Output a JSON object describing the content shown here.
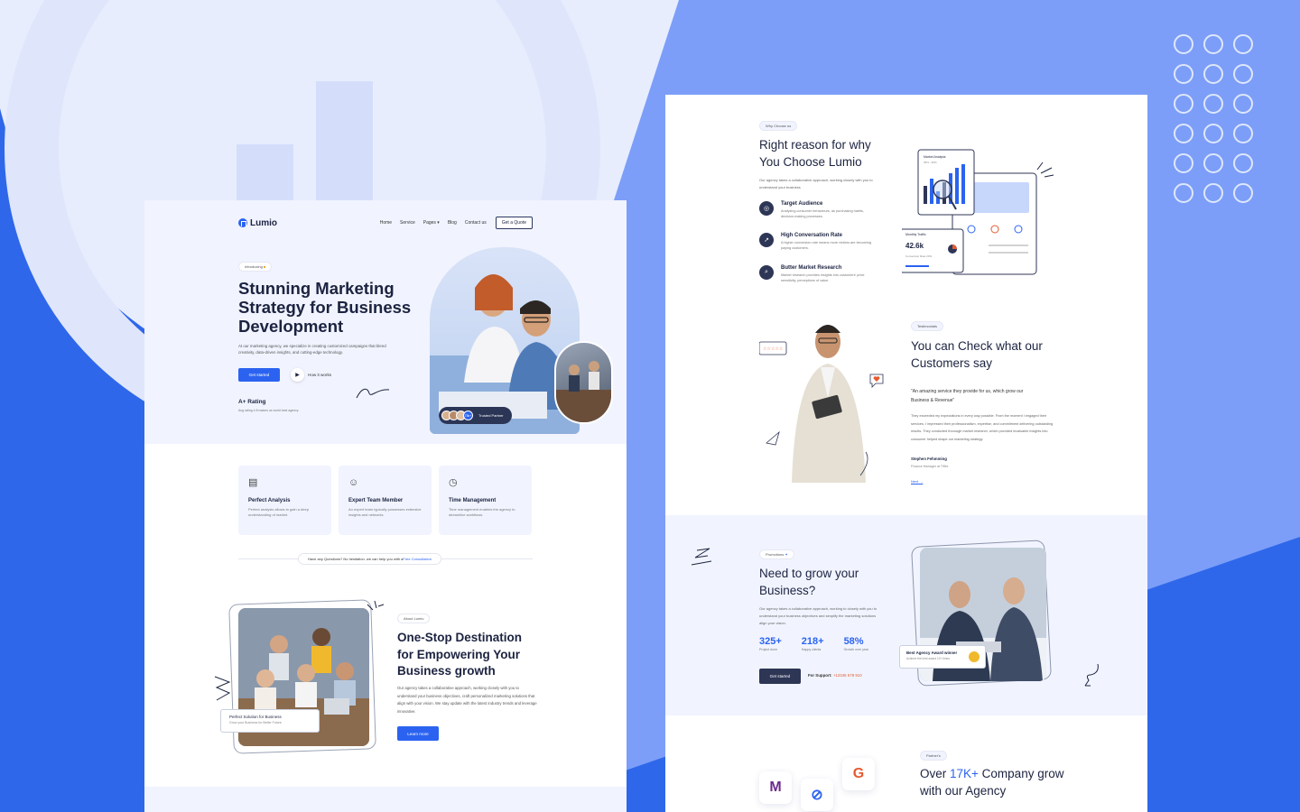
{
  "left_page": {
    "logo": "Lumio",
    "nav": [
      "Home",
      "Service",
      "Pages",
      "Blog",
      "Contact us"
    ],
    "quote_button": "Get a Quote",
    "hero": {
      "badge": "Introducing",
      "title": "Stunning Marketing Strategy for Business Development",
      "description": "At our marketing agency, we specialize in creating customized campaigns that blend creativity, data-driven insights, and cutting-edge technology.",
      "cta": "Get started",
      "play_label": "How it works",
      "rating_title": "A+ Rating",
      "rating_desc": "Avg rating 4.8 makes us world best agency",
      "trusted": "Trusted Partner",
      "avatar_more": "75k+"
    },
    "features": [
      {
        "icon": "analysis-icon",
        "title": "Perfect Analysis",
        "desc": "Perfect analysis allows to gain a deep understanding of market."
      },
      {
        "icon": "team-icon",
        "title": "Expert Team Member",
        "desc": "An expert team typically possesses extensive insights and networks."
      },
      {
        "icon": "clock-icon",
        "title": "Time Management",
        "desc": "Time management enables the agency to streamline workflows."
      }
    ],
    "question": {
      "text": "Have any Questions? No hesitation. we can help you with a ",
      "link": "Free Consultation"
    },
    "about": {
      "badge": "About Lumio",
      "title": "One-Stop Destination for Empowering Your Business growth",
      "description": "Our agency takes a collaborative approach, working closely with you to understand your business objectives, craft personalized marketing solutions that align with your vision. We stay update with the latest industry trends and leverage innovative.",
      "cta": "Learn more",
      "card_title": "Perfect Solution for Business",
      "card_sub": "Grow your Business for Better Future"
    }
  },
  "right_page": {
    "why": {
      "badge": "Why Choose us",
      "title": "Right reason for why You Choose Lumio",
      "description": "Our agency takes a collaborative approach, working closely with you to understand your business",
      "features": [
        {
          "icon": "target-icon",
          "title": "Target Audience",
          "desc": "Analyzing consumer behaviours, as purchasing habits, decision-making processes."
        },
        {
          "icon": "chart-up-icon",
          "title": "High Conversation Rate",
          "desc": "A higher conversion rate means more visitors are becoming paying customers."
        },
        {
          "icon": "research-icon",
          "title": "Butter Market Research",
          "desc": "Market research provides insights into customers' price sensitivity, perceptions of value."
        }
      ],
      "mock": {
        "market_title": "Market Analysis",
        "market_range": "35% - 60%",
        "traffic_title": "Monthly Traffic",
        "traffic_value": "42.6k",
        "traffic_sub": "Conversion Rate 23%"
      }
    },
    "testimonials": {
      "badge": "Testimonials",
      "title": "You can Check what our Customers say",
      "quote": "\"An amazing service they provide for us, which grow our Business & Revenue\"",
      "body": "They exceeded my expectations in every way possible. From the moment I engaged their services, I impressed their professionalism, expertise, and commitment delivering outstanding results. They conducted thorough market research, which provided invaluable insights into consumer helped shape our marketing strategy.",
      "name": "Stephen Fehmming",
      "role": "Finance Manager at Tiffex",
      "next": "Next →"
    },
    "promotion": {
      "badge": "Promotions",
      "title": "Need to grow your Business?",
      "description": "Our agency takes a collaborative approach, working to closely with you to understand your business objectives and simplify the marketing solutions align your vision.",
      "stats": [
        {
          "value": "325+",
          "label": "Project done"
        },
        {
          "value": "218+",
          "label": "Happy clients"
        },
        {
          "value": "58%",
          "label": "Growth over year"
        }
      ],
      "cta": "Get started",
      "support_label": "For Support: ",
      "support_phone": "+12345 678 910",
      "award_title": "Best Agency Award winner",
      "award_sub": "Achieve the best award 10+ times"
    },
    "partners": {
      "badge": "Partner's",
      "title_pre": "Over ",
      "title_accent": "17K+",
      "title_post": " Company grow with our Agency"
    }
  },
  "colors": {
    "accent": "#2b63f0",
    "dark": "#1c2340",
    "bg": "#e8eeff"
  }
}
